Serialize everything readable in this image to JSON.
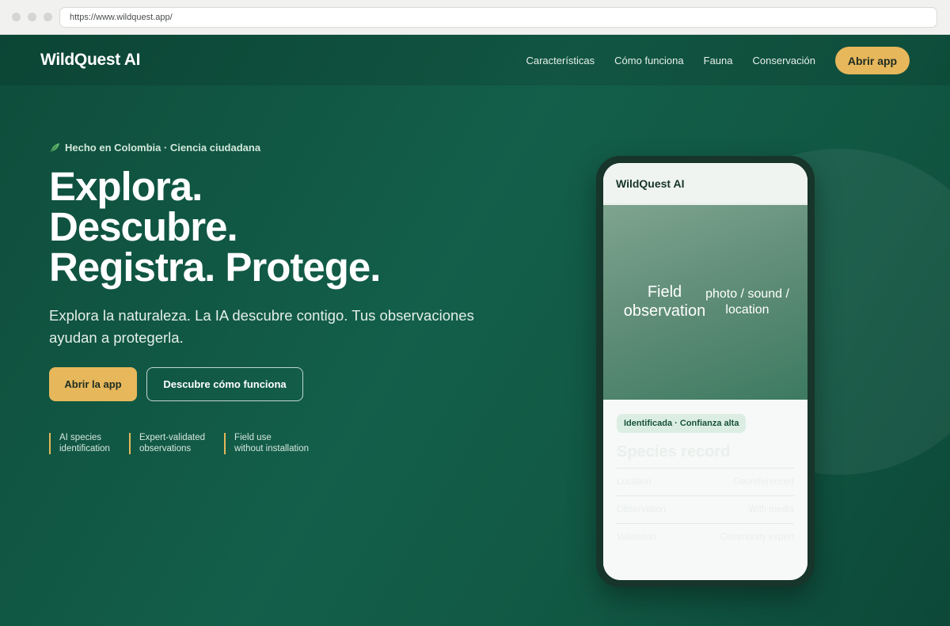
{
  "browser": {
    "url": "https://www.wildquest.app/"
  },
  "nav": {
    "brand": "WildQuest AI",
    "links": [
      "Características",
      "Cómo funciona",
      "Fauna",
      "Conservación"
    ],
    "cta_label": "Abrir app"
  },
  "hero": {
    "badge": "Hecho en Colombia · Ciencia ciudadana",
    "headline_lines": [
      "Explora.",
      "Descubre.",
      "Registra. Protege."
    ],
    "subtext": "Explora la naturaleza. La IA descubre contigo. Tus observaciones ayudan a protegerla.",
    "primary_button": "Abrir la app",
    "secondary_button": "Descubre cómo funciona",
    "features": [
      [
        "AI species",
        "identification"
      ],
      [
        "Expert-validated",
        "observations"
      ],
      [
        "Field use",
        "without installation"
      ]
    ]
  },
  "phone": {
    "app_title": "WildQuest AI",
    "photo_label": "Field observation",
    "photo_sub": "photo / sound / location",
    "confidence_badge": "Identificada · Confianza alta",
    "record_title": "Species record",
    "rows": [
      {
        "label": "Location",
        "value": "Georeferenced"
      },
      {
        "label": "Observation",
        "value": "With media"
      },
      {
        "label": "Validation",
        "value": "Community expert"
      }
    ]
  },
  "colors": {
    "accent": "#e6b75b",
    "background": "#125a46",
    "phone_frame": "#17352a"
  }
}
